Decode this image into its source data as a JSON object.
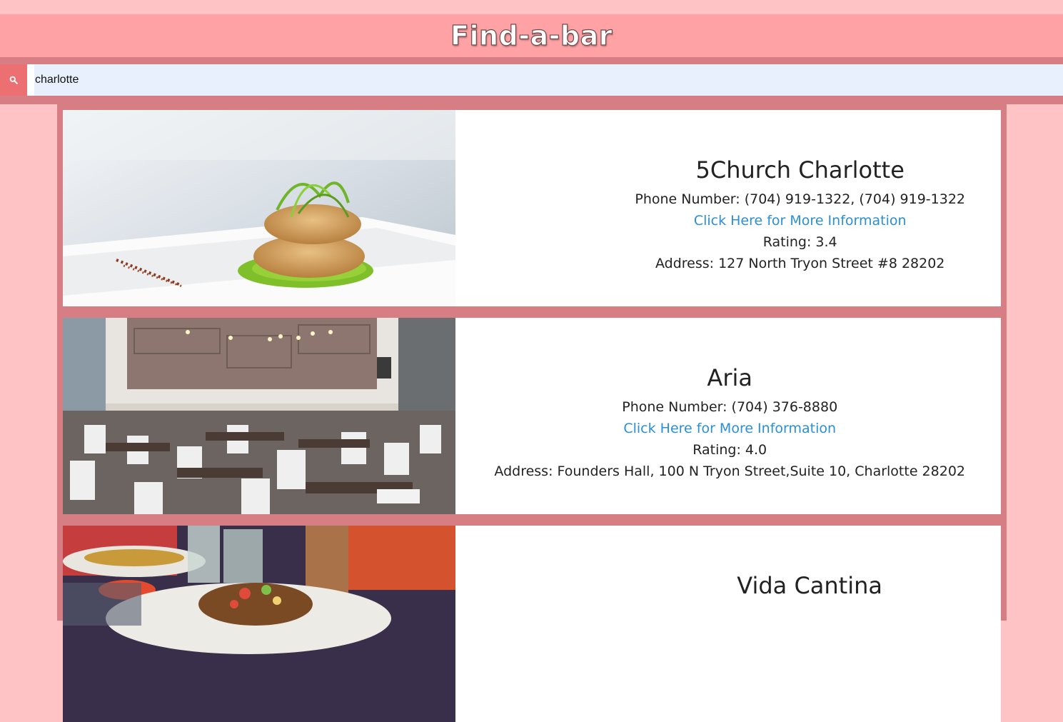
{
  "header": {
    "title": "Find-a-bar"
  },
  "search": {
    "value": "charlotte",
    "icon": "search-icon"
  },
  "colors": {
    "page_bg": "#fec3c5",
    "header_bg": "#fea2a6",
    "frame": "#d67e83",
    "search_button": "#ec7072",
    "link": "#2a8fd6"
  },
  "results": [
    {
      "name": "5Church Charlotte",
      "phone": "Phone Number: (704) 919-1322, (704) 919-1322",
      "link": "Click Here for More Information",
      "rating": "Rating: 3.4",
      "address": "Address: 127 North Tryon Street #8 28202"
    },
    {
      "name": "Aria",
      "phone": "Phone Number: (704) 376-8880",
      "link": "Click Here for More Information",
      "rating": "Rating: 4.0",
      "address": "Address: Founders Hall, 100 N Tryon Street,Suite 10, Charlotte 28202"
    },
    {
      "name": "Vida Cantina",
      "phone": "",
      "link": "",
      "rating": "",
      "address": ""
    }
  ]
}
